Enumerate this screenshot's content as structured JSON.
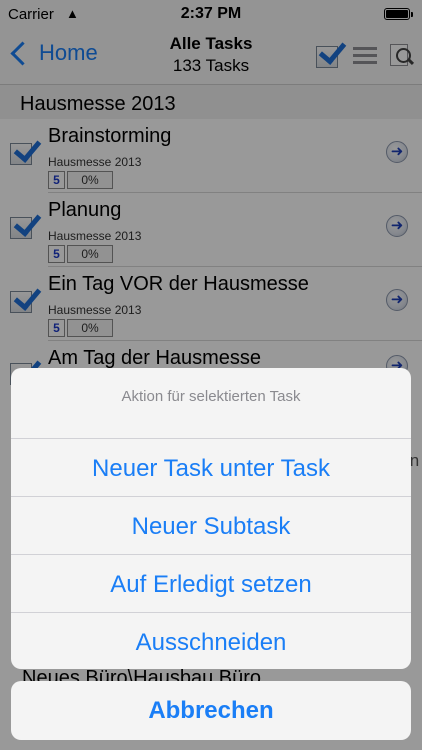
{
  "status_bar": {
    "carrier": "Carrier",
    "time": "2:37 PM"
  },
  "nav": {
    "back_label": "Home",
    "title": "Alle Tasks",
    "subtitle": "133 Tasks"
  },
  "section": {
    "title": "Hausmesse 2013"
  },
  "tasks": [
    {
      "title": "Brainstorming",
      "project": "Hausmesse 2013",
      "priority": "5",
      "progress": "0%"
    },
    {
      "title": "Planung",
      "project": "Hausmesse 2013",
      "priority": "5",
      "progress": "0%"
    },
    {
      "title": "Ein Tag VOR der Hausmesse",
      "project": "Hausmesse 2013",
      "priority": "5",
      "progress": "0%"
    }
  ],
  "partial_task": {
    "title": "Am Tag der Hausmesse"
  },
  "background_fragments": {
    "cut_off_text": "reiben",
    "bottom_project": "Neues Büro\\Hausbau Büro"
  },
  "action_sheet": {
    "header": "Aktion für selektierten Task",
    "items": [
      "Neuer Task unter Task",
      "Neuer Subtask",
      "Auf Erledigt setzen",
      "Ausschneiden"
    ],
    "cancel": "Abbrechen"
  },
  "colors": {
    "accent": "#1a7ef6",
    "check": "#1f6fd6",
    "priority": "#1c39c9"
  }
}
